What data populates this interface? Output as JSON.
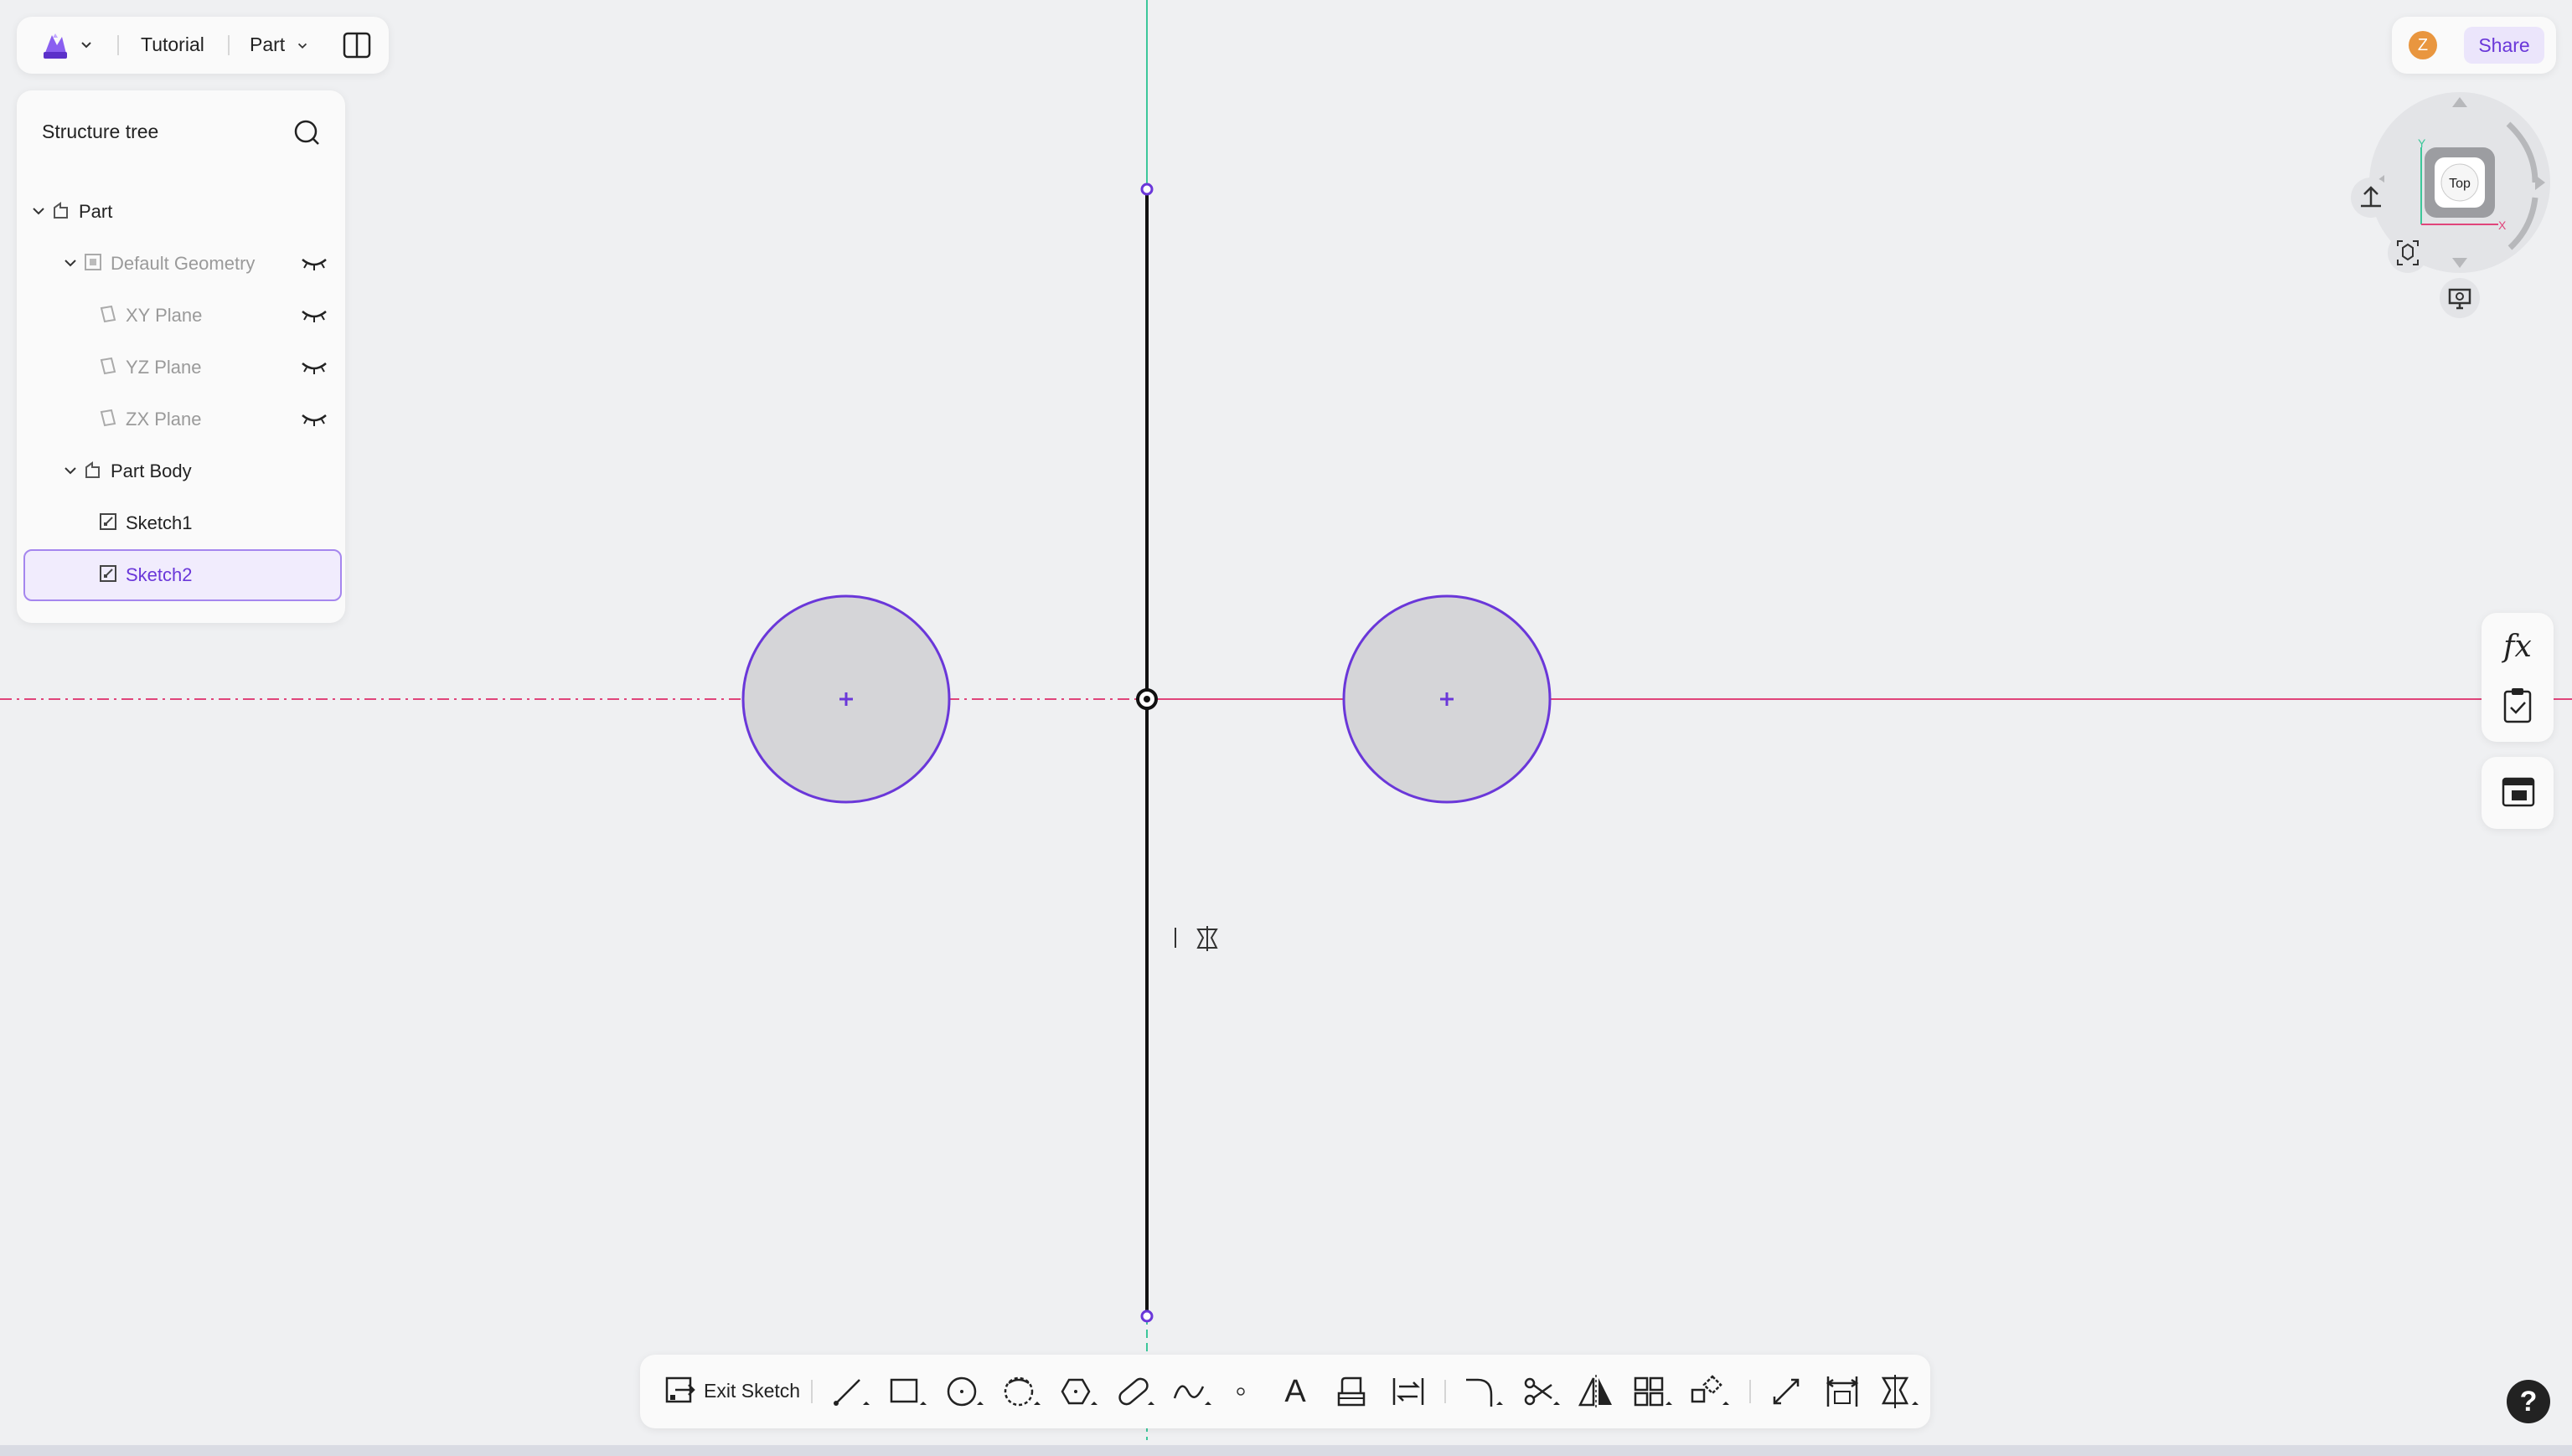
{
  "topbar": {
    "menu_1": "Tutorial",
    "menu_2": "Part"
  },
  "structure_tree": {
    "title": "Structure tree",
    "items": [
      {
        "label": "Part"
      },
      {
        "label": "Default Geometry"
      },
      {
        "label": "XY Plane"
      },
      {
        "label": "YZ Plane"
      },
      {
        "label": "ZX Plane"
      },
      {
        "label": "Part Body"
      },
      {
        "label": "Sketch1"
      },
      {
        "label": "Sketch2"
      }
    ]
  },
  "header_right": {
    "avatar_letter": "Z",
    "share_label": "Share"
  },
  "view_cube": {
    "face_label": "Top",
    "axis_y": "Y",
    "axis_x": "X"
  },
  "side_tools": {
    "formula_label": "fx"
  },
  "bottom_toolbar": {
    "exit_label": "Exit Sketch",
    "text_tool_glyph": "A"
  },
  "help": {
    "label": "?"
  },
  "colors": {
    "accent": "#6a37d9",
    "circle_fill": "#d5d5d8",
    "x_axis": "#e0457b",
    "y_axis": "#3cc79a",
    "canvas": "#eff0f2"
  }
}
